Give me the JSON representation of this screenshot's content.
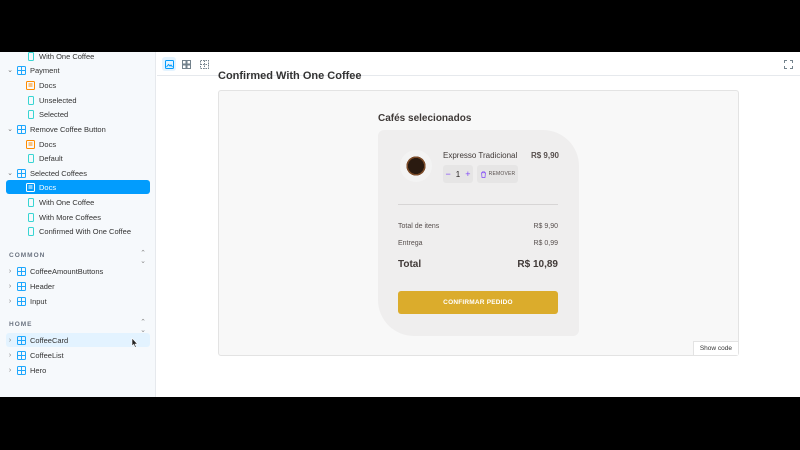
{
  "sidebar": {
    "partial_top_label": "With One Coffee",
    "payment": {
      "label": "Payment",
      "docs": "Docs",
      "unselected": "Unselected",
      "selected": "Selected"
    },
    "remove_button": {
      "label": "Remove Coffee Button",
      "docs": "Docs",
      "default": "Default"
    },
    "selected_coffees": {
      "label": "Selected Coffees",
      "docs": "Docs",
      "one": "With One Coffee",
      "more": "With More Coffees",
      "confirmed": "Confirmed With One Coffee"
    },
    "common": {
      "label": "COMMON",
      "items": [
        "CoffeeAmountButtons",
        "Header",
        "Input"
      ]
    },
    "home": {
      "label": "HOME",
      "items": [
        "CoffeeCard",
        "CoffeeList",
        "Hero"
      ]
    }
  },
  "canvas": {
    "story_title": "Confirmed With One Coffee",
    "show_code": "Show code"
  },
  "cart": {
    "title": "Cafés selecionados",
    "item_name": "Expresso Tradicional",
    "item_price": "R$ 9,90",
    "quantity": "1",
    "remove_label": "REMOVER",
    "items_total_label": "Total de itens",
    "items_total_value": "R$ 9,90",
    "delivery_label": "Entrega",
    "delivery_value": "R$ 0,99",
    "total_label": "Total",
    "total_value": "R$ 10,89",
    "confirm_label": "CONFIRMAR PEDIDO"
  },
  "colors": {
    "accent": "#029cfd",
    "brand_yellow": "#dbac2c",
    "purple": "#8047f8"
  }
}
